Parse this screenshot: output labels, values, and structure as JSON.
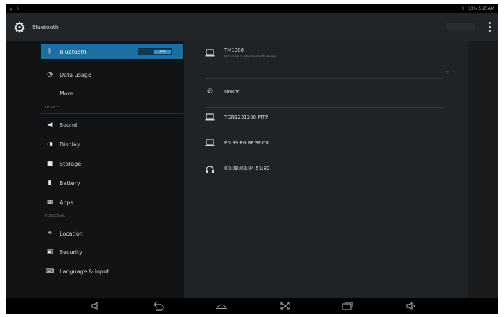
{
  "status_bar": {
    "left_icons": [
      "usb-icon",
      "download-icon"
    ],
    "right_text": "10% 5:25AM"
  },
  "action_bar": {
    "title": "Bluetooth",
    "switch_label": ""
  },
  "sidebar": {
    "items": [
      {
        "id": "bluetooth",
        "label": "Bluetooth",
        "icon": "bluetooth-icon",
        "selected": true,
        "switch": "ON"
      },
      {
        "id": "data-usage",
        "label": "Data usage",
        "icon": "data-usage-icon"
      },
      {
        "id": "more",
        "label": "More...",
        "icon": ""
      },
      {
        "id": "sound",
        "label": "Sound",
        "icon": "speaker-icon"
      },
      {
        "id": "display",
        "label": "Display",
        "icon": "display-icon"
      },
      {
        "id": "storage",
        "label": "Storage",
        "icon": "storage-icon"
      },
      {
        "id": "battery",
        "label": "Battery",
        "icon": "battery-icon"
      },
      {
        "id": "apps",
        "label": "Apps",
        "icon": "apps-icon"
      },
      {
        "id": "location",
        "label": "Location",
        "icon": "location-icon"
      },
      {
        "id": "security",
        "label": "Security",
        "icon": "lock-icon"
      },
      {
        "id": "language",
        "label": "Language & input",
        "icon": "keyboard-icon"
      }
    ],
    "sections": {
      "device": "DEVICE",
      "personal": "PERSONAL"
    }
  },
  "bluetooth_panel": {
    "this_device": {
      "name": "TM1988",
      "subtitle": "Not visible to other Bluetooth devices",
      "icon": "laptop-icon"
    },
    "devices": [
      {
        "name": "N6Bor",
        "icon": "phone-icon"
      },
      {
        "name": "TGN1231208-MTP",
        "icon": "laptop-icon"
      },
      {
        "name": "E0:99:E6:BF:3F:C8",
        "icon": "laptop-icon"
      },
      {
        "name": "00:0B:02:04:51:82",
        "icon": "headset-icon"
      }
    ]
  },
  "navigation": {
    "buttons": [
      "volume-down-icon",
      "back-icon",
      "home-icon",
      "screenshot-icon",
      "recent-apps-icon",
      "volume-up-icon"
    ]
  },
  "colors": {
    "accent": "#1d6fa1",
    "background": "#202325"
  }
}
